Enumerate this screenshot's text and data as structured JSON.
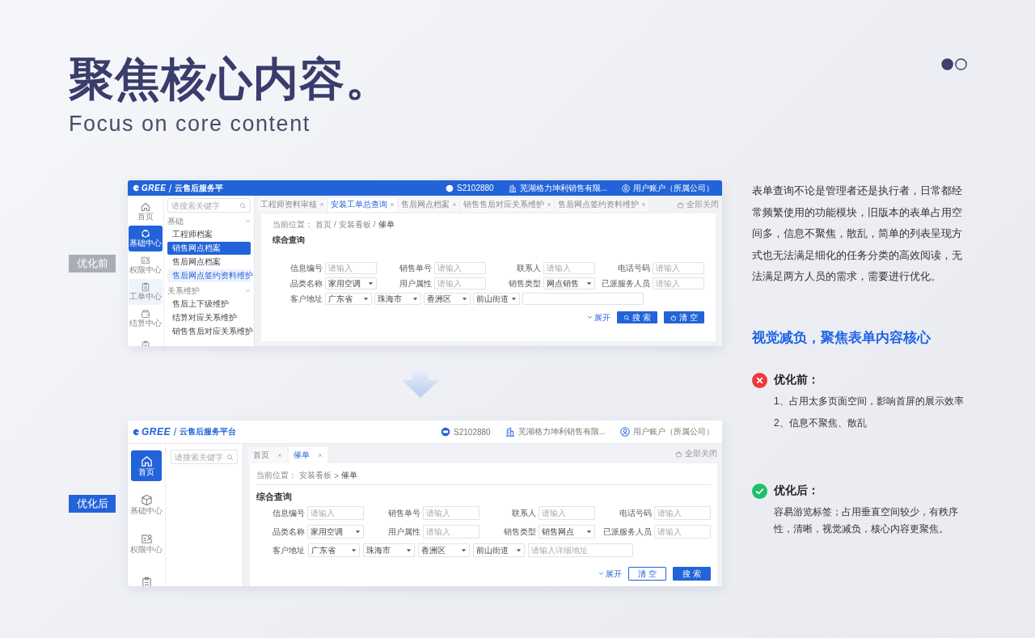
{
  "title": "聚焦核心内容。",
  "subtitle": "Focus on core content",
  "versions": [
    {
      "badge": "优化前",
      "kind": "old",
      "app": {
        "logo": "GREE",
        "platform": "云售后服务平",
        "header_items": [
          {
            "kind": "id",
            "text": "S2102880"
          },
          {
            "kind": "building",
            "text": "芜湖格力坤利销售有限..."
          },
          {
            "kind": "user",
            "text": "用户账户（所属公司）"
          }
        ],
        "rail": [
          {
            "kind": "home",
            "label": "首页",
            "selected": false,
            "highlighted": false
          },
          {
            "kind": "network",
            "label": "基础中心",
            "selected": true,
            "highlighted": false
          },
          {
            "kind": "card",
            "label": "权限中心",
            "selected": false,
            "highlighted": false
          },
          {
            "kind": "clipboard",
            "label": "工单中心",
            "selected": false,
            "highlighted": true
          },
          {
            "kind": "wallet",
            "label": "结算中心",
            "selected": false,
            "highlighted": false
          },
          {
            "kind": "clipboard",
            "selected": false,
            "highlighted": false
          }
        ],
        "search_placeholder": "请搜索关键字",
        "menu": [
          {
            "title": "基础",
            "expanded": true,
            "items": [
              {
                "label": "工程师档案",
                "selected": false,
                "highlighted": false
              },
              {
                "label": "销售网点档案",
                "selected": true,
                "highlighted": false
              },
              {
                "label": "售后网点档案",
                "selected": false,
                "highlighted": false
              },
              {
                "label": "售后网点签约资料维护",
                "selected": false,
                "highlighted": true
              }
            ]
          },
          {
            "title": "关系维护",
            "expanded": true,
            "items": [
              {
                "label": "售后上下级维护",
                "selected": false,
                "highlighted": false
              },
              {
                "label": "结算对应关系维护",
                "selected": false,
                "highlighted": false
              },
              {
                "label": "销售售后对应关系维护",
                "selected": false,
                "highlighted": false
              }
            ]
          }
        ],
        "tabs": [
          {
            "label": "工程师资料审核",
            "selected": false
          },
          {
            "label": "安装工单总查询",
            "selected": true
          },
          {
            "label": "售后网点档案",
            "selected": false
          },
          {
            "label": "销售售后对应关系维护",
            "selected": false
          },
          {
            "label": "售后网点签约资料维护",
            "selected": false
          }
        ],
        "close_all": "全部关闭",
        "breadcrumb": {
          "label": "当前位置：",
          "separator": "/",
          "path": [
            "首页",
            "安装看板",
            "催单"
          ]
        },
        "form_title": "综合查询",
        "fields": [
          {
            "label": "信息编号",
            "kind": "input",
            "placeholder": "请输入"
          },
          {
            "label": "销售单号",
            "kind": "input",
            "placeholder": "请输入"
          },
          {
            "label": "联系人",
            "kind": "input",
            "placeholder": "请输入"
          },
          {
            "label": "电话号码",
            "kind": "input",
            "placeholder": "请输入"
          },
          {
            "label": "品类名称",
            "kind": "select",
            "value": "家用空调"
          },
          {
            "label": "用户属性",
            "kind": "input",
            "placeholder": "请输入"
          },
          {
            "label": "销售类型",
            "kind": "select",
            "value": "网点销售"
          },
          {
            "label": "已派服务人员",
            "kind": "input",
            "placeholder": "请输入"
          }
        ],
        "address": {
          "label": "客户地址",
          "selects": [
            "广东省",
            "珠海市",
            "香洲区",
            "前山街道"
          ]
        },
        "expand": "展开",
        "buttons": [
          {
            "label": "搜 索",
            "kind": "search"
          },
          {
            "label": "清 空",
            "kind": "clear"
          }
        ]
      }
    },
    {
      "badge": "优化后",
      "kind": "new",
      "app": {
        "logo": "GREE",
        "platform": "云售后服务平台",
        "header_items": [
          {
            "kind": "id",
            "text": "S2102880"
          },
          {
            "kind": "building",
            "text": "芜湖格力坤利销售有限..."
          },
          {
            "kind": "user",
            "text": "用户账户（所属公司）"
          }
        ],
        "rail": [
          {
            "kind": "home",
            "label": "首页",
            "selected": true,
            "highlighted": false
          },
          {
            "kind": "cube",
            "label": "基础中心",
            "selected": false,
            "highlighted": false
          },
          {
            "kind": "card",
            "label": "权限中心",
            "selected": false,
            "highlighted": false
          },
          {
            "kind": "clipboard",
            "selected": false,
            "highlighted": false
          }
        ],
        "search_placeholder": "请搜索关键字",
        "tabs": [
          {
            "label": "首页",
            "selected": false
          },
          {
            "label": "催单",
            "selected": true
          }
        ],
        "close_all": "全部关闭",
        "breadcrumb": {
          "label": "当前位置：",
          "separator": ">",
          "path": [
            "安装看板",
            "催单"
          ]
        },
        "form_title": "综合查询",
        "fields": [
          {
            "label": "信息编号",
            "kind": "input",
            "placeholder": "请输入"
          },
          {
            "label": "销售单号",
            "kind": "input",
            "placeholder": "请输入"
          },
          {
            "label": "联系人",
            "kind": "input",
            "placeholder": "请输入"
          },
          {
            "label": "电话号码",
            "kind": "input",
            "placeholder": "请输入"
          },
          {
            "label": "品类名称",
            "kind": "select",
            "value": "家用空调"
          },
          {
            "label": "用户属性",
            "kind": "input",
            "placeholder": "请输入"
          },
          {
            "label": "销售类型",
            "kind": "select",
            "value": "销售网点"
          },
          {
            "label": "已派服务人员",
            "kind": "input",
            "placeholder": "请输入"
          }
        ],
        "address": {
          "label": "客户地址",
          "selects": [
            "广东省",
            "珠海市",
            "香洲区",
            "前山街道"
          ],
          "detail_placeholder": "请输入详细地址"
        },
        "expand": "展开",
        "buttons": [
          {
            "label": "清 空",
            "kind": "clear"
          },
          {
            "label": "搜 索",
            "kind": "search"
          }
        ]
      }
    }
  ],
  "description": "表单查询不论是管理者还是执行者，日常都经常频繁使用的功能模块，旧版本的表单占用空间多，信息不聚焦，散乱，简单的列表呈现方式也无法满足细化的任务分类的高效阅读，无法满足两方人员的需求，需要进行优化。",
  "heading": "视觉减负，聚焦表单内容核心",
  "points": [
    {
      "kind": "bad",
      "title": "优化前：",
      "lines": [
        "1、占用太多页面空间，影响首屏的展示效率",
        "2、信息不聚焦、散乱"
      ]
    },
    {
      "kind": "good",
      "title": "优化后：",
      "lines": [
        "容易游览标签；占用垂直空间较少，有秩序性，清晰，视觉减负，核心内容更聚焦。"
      ]
    }
  ]
}
